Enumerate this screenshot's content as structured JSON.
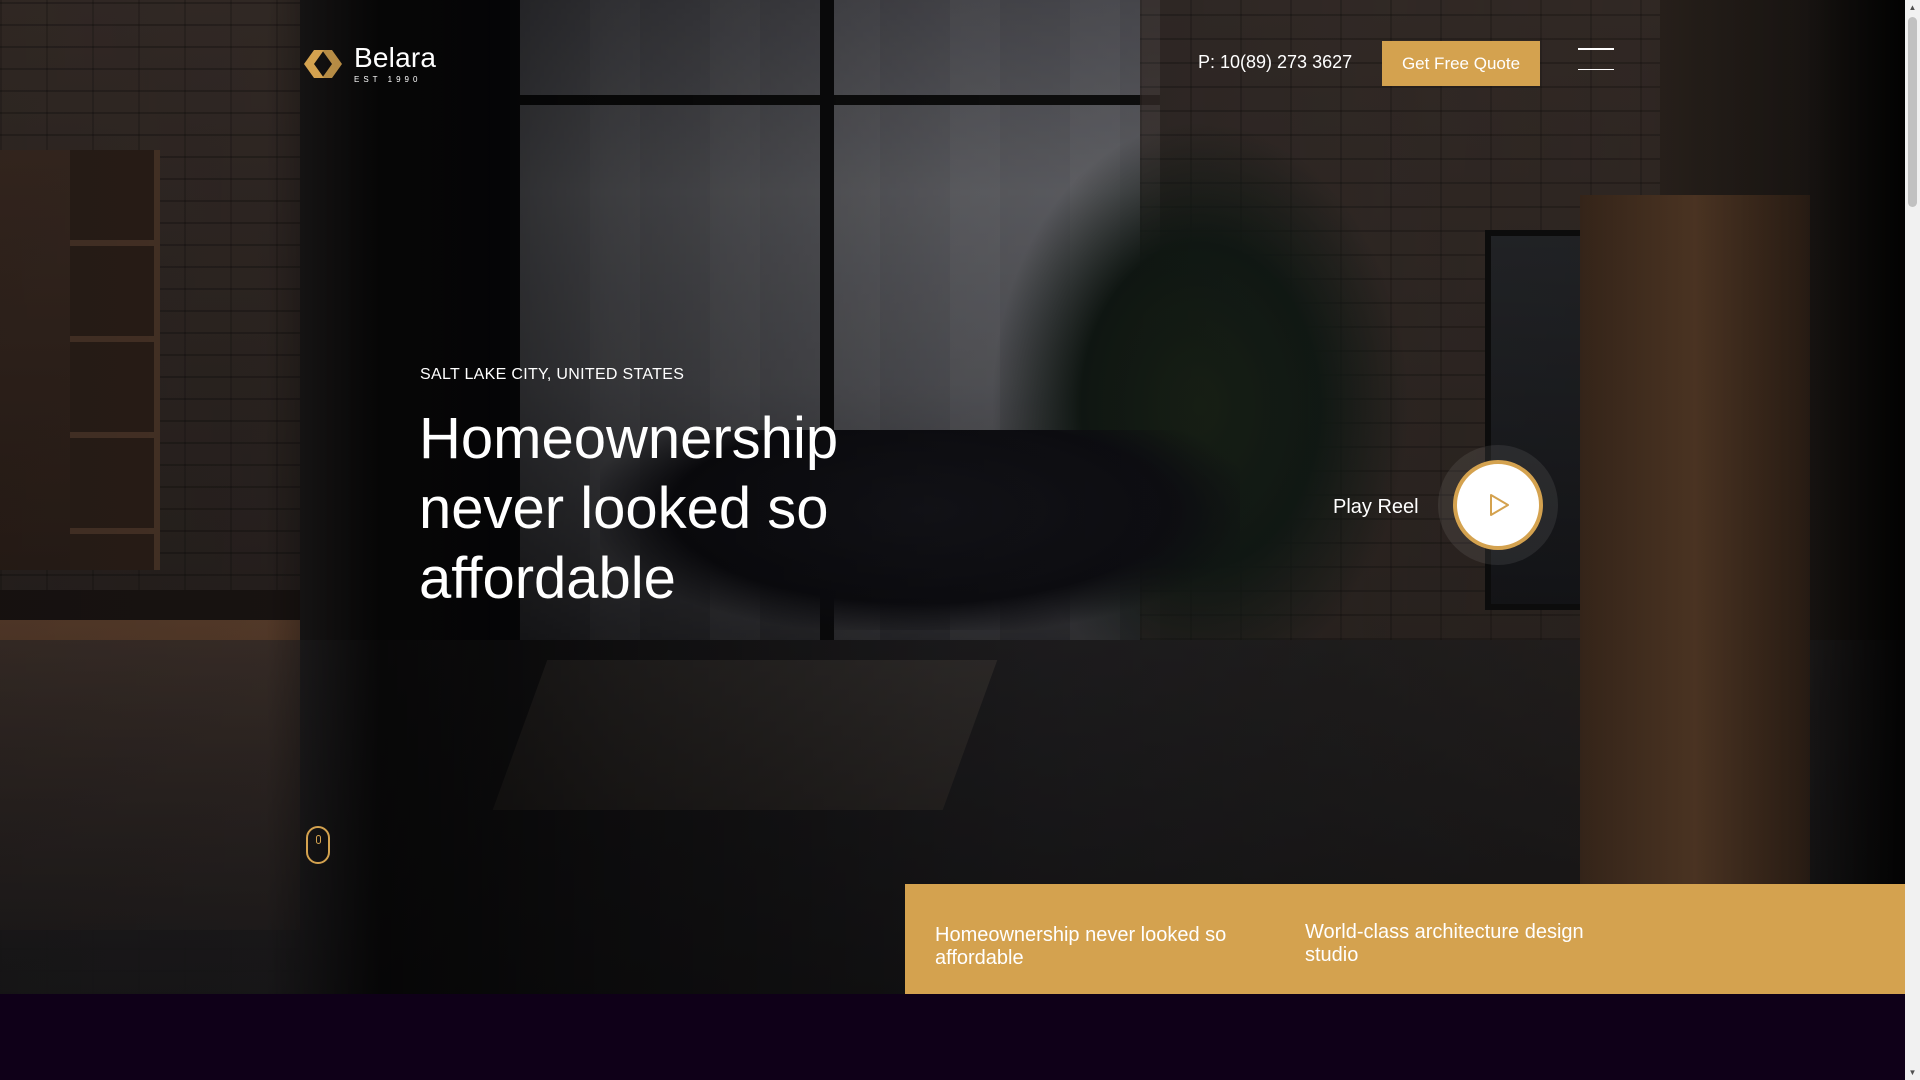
{
  "header": {
    "logo_name": "Belara",
    "logo_est": "EST 1990",
    "phone": "P: 10(89) 273 3627",
    "quote_button": "Get Free Quote"
  },
  "hero": {
    "location": "SALT LAKE CITY, UNITED STATES",
    "headline": "Homeownership never looked so affordable",
    "play_label": "Play Reel"
  },
  "info_bar": {
    "items": [
      "Homeownership never looked so affordable",
      "World-class architecture design studio"
    ]
  },
  "colors": {
    "accent": "#d4a24f",
    "page_bottom": "#0f0018"
  },
  "icons": {
    "menu": "hamburger-icon",
    "play": "play-icon",
    "scroll": "mouse-scroll-icon"
  }
}
